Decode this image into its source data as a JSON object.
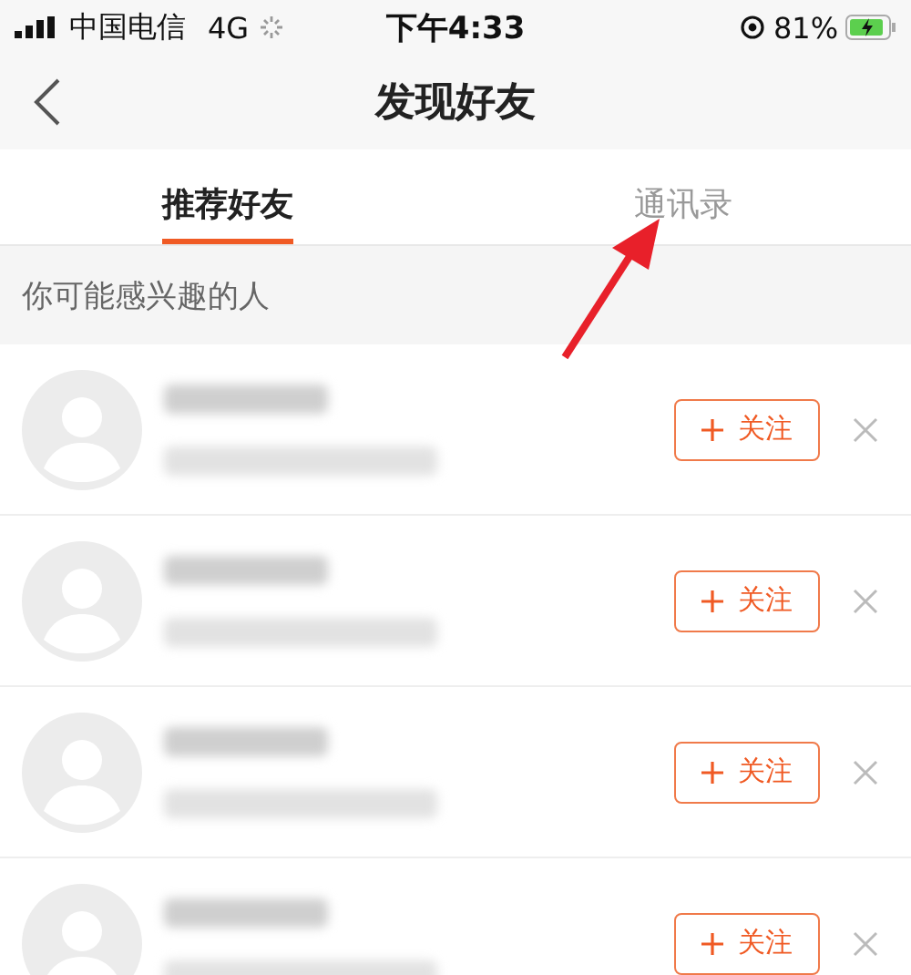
{
  "status_bar": {
    "carrier": "中国电信",
    "network": "4G",
    "time": "下午4:33",
    "battery": "81%"
  },
  "nav": {
    "title": "发现好友"
  },
  "tabs": [
    {
      "label": "推荐好友",
      "selected": true
    },
    {
      "label": "通讯录",
      "selected": false
    }
  ],
  "section_title": "你可能感兴趣的人",
  "people": [
    {
      "follow_label": "关注"
    },
    {
      "follow_label": "关注"
    },
    {
      "follow_label": "关注"
    },
    {
      "follow_label": "关注"
    }
  ]
}
